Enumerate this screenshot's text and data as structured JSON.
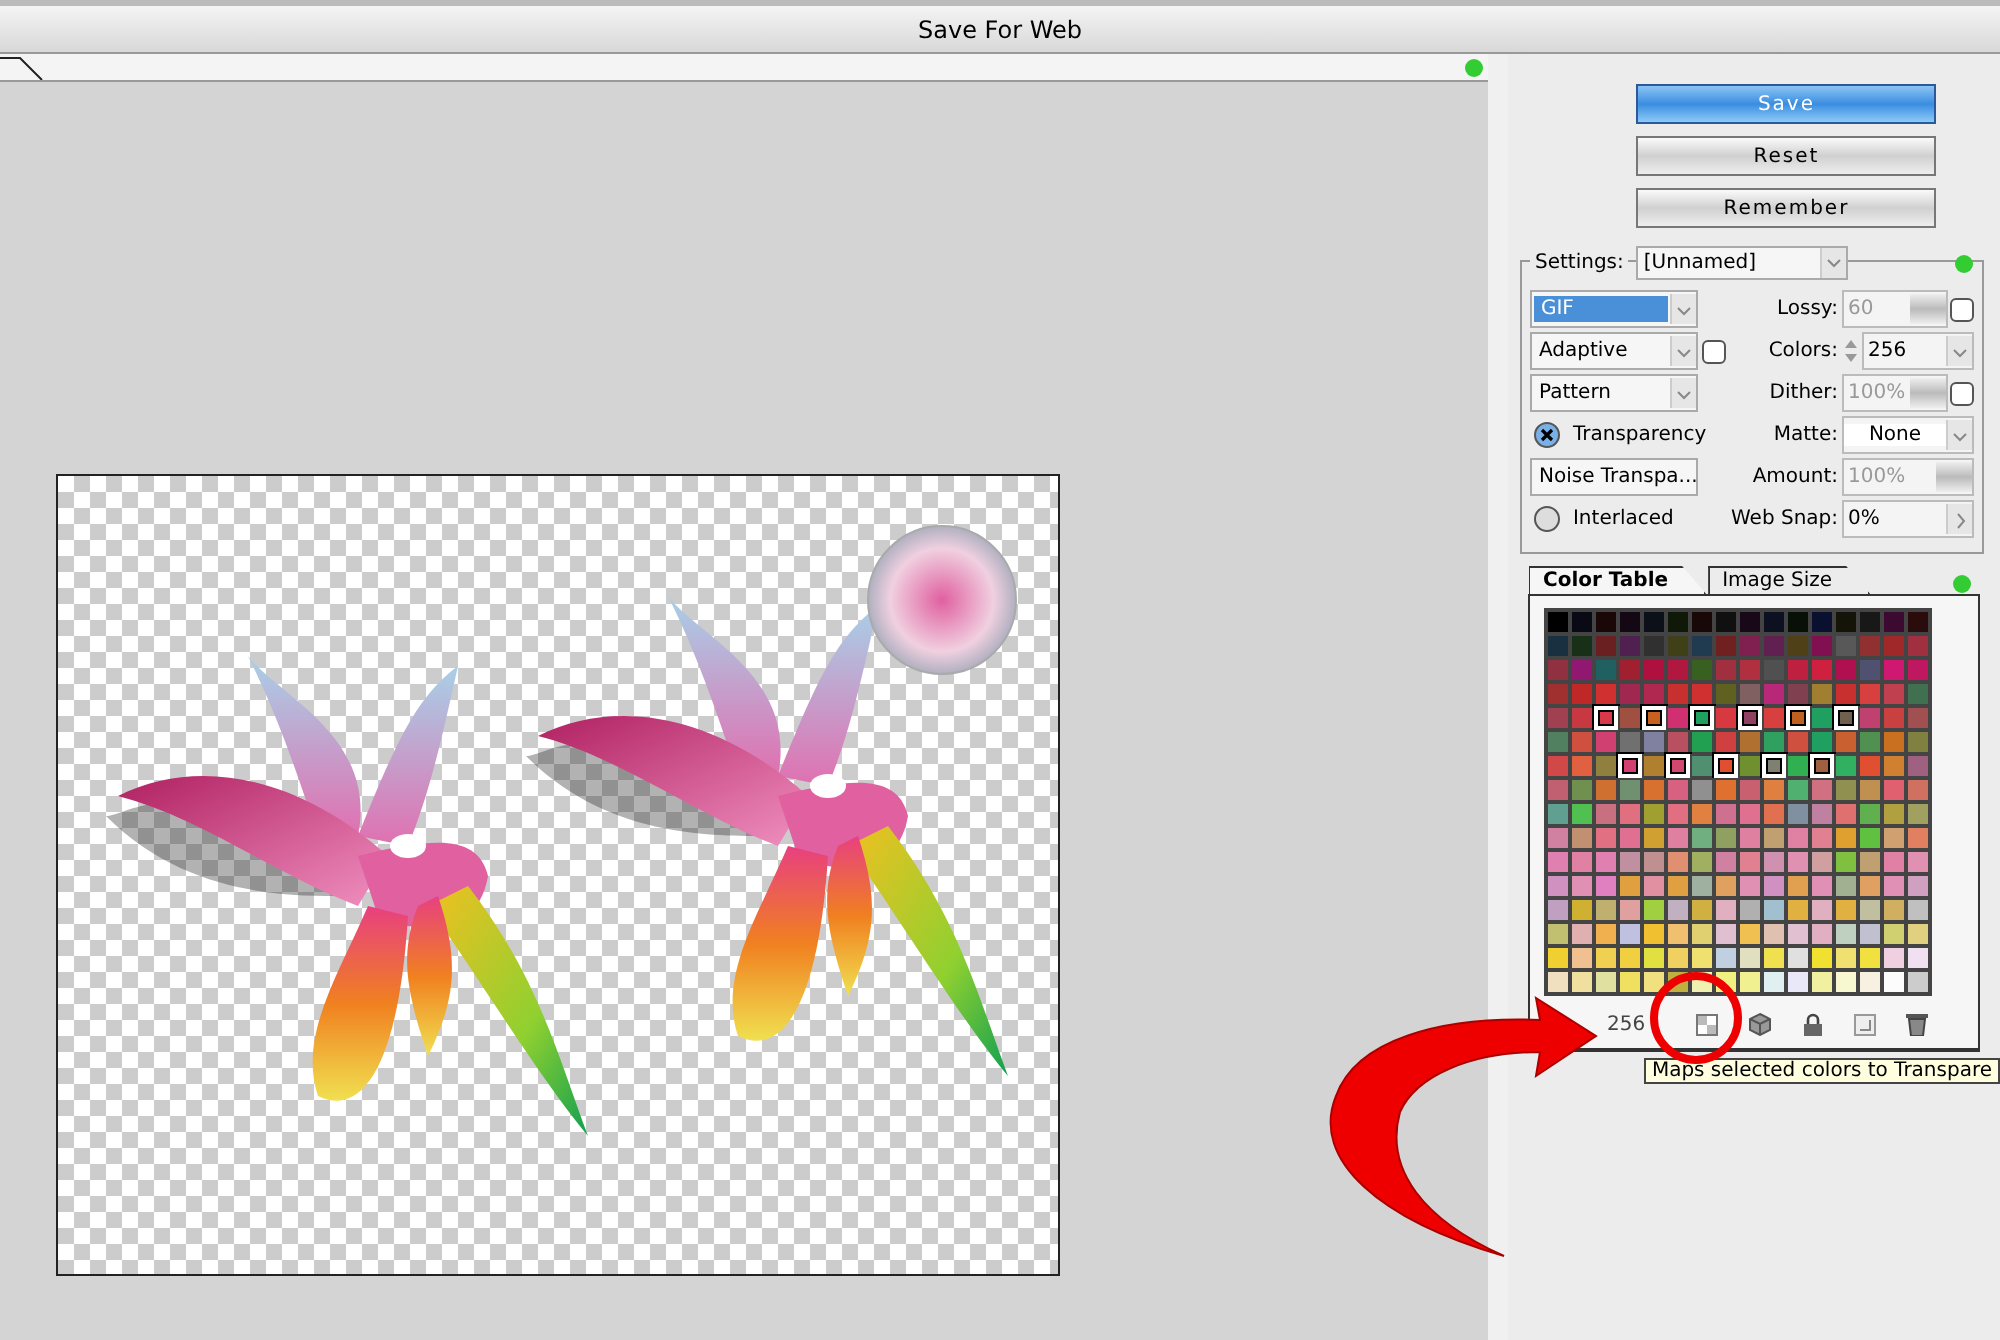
{
  "window": {
    "title": "Save For Web"
  },
  "buttons": [
    {
      "label": "Save",
      "default": true
    },
    {
      "label": "Reset",
      "default": false
    },
    {
      "label": "Remember",
      "default": false
    }
  ],
  "settings": {
    "label": "Settings:",
    "preset": "[Unnamed]",
    "left": [
      {
        "kind": "dropdown",
        "value": "GIF",
        "highlighted": true,
        "extra_button": false
      },
      {
        "kind": "dropdown",
        "value": "Adaptive",
        "highlighted": false,
        "extra_button": true
      },
      {
        "kind": "dropdown",
        "value": "Pattern",
        "highlighted": false,
        "extra_button": false
      },
      {
        "kind": "checkbox",
        "label": "Transparency",
        "checked": true
      },
      {
        "kind": "dropdown",
        "value": "Noise Transpa...",
        "highlighted": false,
        "extra_button": false
      },
      {
        "kind": "checkbox",
        "label": "Interlaced",
        "checked": false
      }
    ],
    "right": [
      {
        "kind": "slider",
        "label": "Lossy:",
        "value": "60",
        "disabled": true,
        "extra_button": true
      },
      {
        "kind": "stepper",
        "label": "Colors:",
        "value": "256",
        "disabled": false,
        "extra_button": false
      },
      {
        "kind": "slider",
        "label": "Dither:",
        "value": "100%",
        "disabled": true,
        "extra_button": true
      },
      {
        "kind": "dropdown",
        "label": "Matte:",
        "value": "None",
        "disabled": false,
        "extra_button": false
      },
      {
        "kind": "slider",
        "label": "Amount:",
        "value": "100%",
        "disabled": true,
        "extra_button": false
      },
      {
        "kind": "arrow",
        "label": "Web Snap:",
        "value": "0%",
        "disabled": false,
        "extra_button": false
      }
    ]
  },
  "tabs": [
    {
      "label": "Color Table",
      "selected": true
    },
    {
      "label": "Image Size",
      "selected": false
    }
  ],
  "color_table": {
    "count": "256",
    "tooltip": "Maps selected colors to Transpare",
    "rows": [
      {
        "swatches": [
          {
            "color": "#000000",
            "selected": false
          },
          {
            "color": "#0a0a14",
            "selected": false
          },
          {
            "color": "#1a0808",
            "selected": false
          },
          {
            "color": "#140814",
            "selected": false
          },
          {
            "color": "#0c1018",
            "selected": false
          },
          {
            "color": "#101808",
            "selected": false
          },
          {
            "color": "#180808",
            "selected": false
          },
          {
            "color": "#101010",
            "selected": false
          },
          {
            "color": "#180818",
            "selected": false
          },
          {
            "color": "#0c1020",
            "selected": false
          },
          {
            "color": "#081008",
            "selected": false
          },
          {
            "color": "#0c1030",
            "selected": false
          },
          {
            "color": "#141408",
            "selected": false
          },
          {
            "color": "#181818",
            "selected": false
          },
          {
            "color": "#3c0a30",
            "selected": false
          },
          {
            "color": "#2a0c0c",
            "selected": false
          }
        ]
      },
      {
        "swatches": [
          {
            "color": "#183040",
            "selected": false
          },
          {
            "color": "#183018",
            "selected": false
          },
          {
            "color": "#6a2020",
            "selected": false
          },
          {
            "color": "#502050",
            "selected": false
          },
          {
            "color": "#303030",
            "selected": false
          },
          {
            "color": "#404018",
            "selected": false
          },
          {
            "color": "#203a50",
            "selected": false
          },
          {
            "color": "#702020",
            "selected": false
          },
          {
            "color": "#802050",
            "selected": false
          },
          {
            "color": "#602050",
            "selected": false
          },
          {
            "color": "#504018",
            "selected": false
          },
          {
            "color": "#801050",
            "selected": false
          },
          {
            "color": "#585858",
            "selected": false
          },
          {
            "color": "#903030",
            "selected": false
          },
          {
            "color": "#a02828",
            "selected": false
          },
          {
            "color": "#a03040",
            "selected": false
          }
        ]
      },
      {
        "swatches": [
          {
            "color": "#903040",
            "selected": false
          },
          {
            "color": "#901870",
            "selected": false
          },
          {
            "color": "#206060",
            "selected": false
          },
          {
            "color": "#a02030",
            "selected": false
          },
          {
            "color": "#b01040",
            "selected": false
          },
          {
            "color": "#b01840",
            "selected": false
          },
          {
            "color": "#386020",
            "selected": false
          },
          {
            "color": "#a03040",
            "selected": false
          },
          {
            "color": "#b03040",
            "selected": false
          },
          {
            "color": "#505050",
            "selected": false
          },
          {
            "color": "#c02040",
            "selected": false
          },
          {
            "color": "#d02040",
            "selected": false
          },
          {
            "color": "#b01050",
            "selected": false
          },
          {
            "color": "#505070",
            "selected": false
          },
          {
            "color": "#d01870",
            "selected": false
          },
          {
            "color": "#c01860",
            "selected": false
          }
        ]
      },
      {
        "swatches": [
          {
            "color": "#a03030",
            "selected": false
          },
          {
            "color": "#c02828",
            "selected": false
          },
          {
            "color": "#d03030",
            "selected": false
          },
          {
            "color": "#a02850",
            "selected": false
          },
          {
            "color": "#b02850",
            "selected": false
          },
          {
            "color": "#c83030",
            "selected": false
          },
          {
            "color": "#d03030",
            "selected": false
          },
          {
            "color": "#606020",
            "selected": false
          },
          {
            "color": "#806060",
            "selected": false
          },
          {
            "color": "#b82878",
            "selected": false
          },
          {
            "color": "#804050",
            "selected": false
          },
          {
            "color": "#a08030",
            "selected": false
          },
          {
            "color": "#c83030",
            "selected": false
          },
          {
            "color": "#d84040",
            "selected": false
          },
          {
            "color": "#c04050",
            "selected": false
          },
          {
            "color": "#407050",
            "selected": false
          }
        ]
      },
      {
        "swatches": [
          {
            "color": "#a04050",
            "selected": false
          },
          {
            "color": "#c83840",
            "selected": false
          },
          {
            "color": "#d83848",
            "selected": true
          },
          {
            "color": "#a05040",
            "selected": false
          },
          {
            "color": "#c86020",
            "selected": true
          },
          {
            "color": "#d03070",
            "selected": false
          },
          {
            "color": "#20a060",
            "selected": true
          },
          {
            "color": "#d83840",
            "selected": false
          },
          {
            "color": "#904060",
            "selected": true
          },
          {
            "color": "#d84040",
            "selected": false
          },
          {
            "color": "#c06020",
            "selected": true
          },
          {
            "color": "#20a060",
            "selected": false
          },
          {
            "color": "#706050",
            "selected": true
          },
          {
            "color": "#c04070",
            "selected": false
          },
          {
            "color": "#c84040",
            "selected": false
          },
          {
            "color": "#a05050",
            "selected": false
          }
        ]
      },
      {
        "swatches": [
          {
            "color": "#508060",
            "selected": false
          },
          {
            "color": "#d05040",
            "selected": false
          },
          {
            "color": "#d04070",
            "selected": false
          },
          {
            "color": "#707070",
            "selected": false
          },
          {
            "color": "#8080a0",
            "selected": false
          },
          {
            "color": "#b85060",
            "selected": false
          },
          {
            "color": "#20a050",
            "selected": false
          },
          {
            "color": "#d04040",
            "selected": false
          },
          {
            "color": "#b07030",
            "selected": false
          },
          {
            "color": "#30a060",
            "selected": false
          },
          {
            "color": "#d05040",
            "selected": false
          },
          {
            "color": "#20a060",
            "selected": false
          },
          {
            "color": "#c86030",
            "selected": false
          },
          {
            "color": "#509050",
            "selected": false
          },
          {
            "color": "#c87020",
            "selected": false
          },
          {
            "color": "#808040",
            "selected": false
          }
        ]
      },
      {
        "swatches": [
          {
            "color": "#d04848",
            "selected": false
          },
          {
            "color": "#e06040",
            "selected": false
          },
          {
            "color": "#908040",
            "selected": false
          },
          {
            "color": "#d04070",
            "selected": true
          },
          {
            "color": "#b08030",
            "selected": false
          },
          {
            "color": "#d04870",
            "selected": true
          },
          {
            "color": "#509070",
            "selected": false
          },
          {
            "color": "#e05030",
            "selected": true
          },
          {
            "color": "#709030",
            "selected": false
          },
          {
            "color": "#808070",
            "selected": true
          },
          {
            "color": "#30b050",
            "selected": false
          },
          {
            "color": "#a06040",
            "selected": true
          },
          {
            "color": "#30b060",
            "selected": false
          },
          {
            "color": "#e05030",
            "selected": false
          },
          {
            "color": "#d08030",
            "selected": false
          },
          {
            "color": "#a06080",
            "selected": false
          }
        ]
      },
      {
        "swatches": [
          {
            "color": "#c06070",
            "selected": false
          },
          {
            "color": "#709050",
            "selected": false
          },
          {
            "color": "#d07030",
            "selected": false
          },
          {
            "color": "#709070",
            "selected": false
          },
          {
            "color": "#d87030",
            "selected": false
          },
          {
            "color": "#d86080",
            "selected": false
          },
          {
            "color": "#909090",
            "selected": false
          },
          {
            "color": "#e07030",
            "selected": false
          },
          {
            "color": "#c86070",
            "selected": false
          },
          {
            "color": "#e08040",
            "selected": false
          },
          {
            "color": "#50b070",
            "selected": false
          },
          {
            "color": "#d07080",
            "selected": false
          },
          {
            "color": "#909050",
            "selected": false
          },
          {
            "color": "#c09050",
            "selected": false
          },
          {
            "color": "#e06070",
            "selected": false
          },
          {
            "color": "#d07060",
            "selected": false
          }
        ]
      },
      {
        "swatches": [
          {
            "color": "#60a090",
            "selected": false
          },
          {
            "color": "#50c050",
            "selected": false
          },
          {
            "color": "#c87080",
            "selected": false
          },
          {
            "color": "#e07080",
            "selected": false
          },
          {
            "color": "#a0a030",
            "selected": false
          },
          {
            "color": "#e07081",
            "selected": false
          },
          {
            "color": "#e08041",
            "selected": false
          },
          {
            "color": "#d07090",
            "selected": false
          },
          {
            "color": "#e07090",
            "selected": false
          },
          {
            "color": "#e07050",
            "selected": false
          },
          {
            "color": "#8090a0",
            "selected": false
          },
          {
            "color": "#c080a0",
            "selected": false
          },
          {
            "color": "#e07070",
            "selected": false
          },
          {
            "color": "#60b050",
            "selected": false
          },
          {
            "color": "#b0a040",
            "selected": false
          },
          {
            "color": "#a0a060",
            "selected": false
          }
        ]
      },
      {
        "swatches": [
          {
            "color": "#d080a0",
            "selected": false
          },
          {
            "color": "#c09070",
            "selected": false
          },
          {
            "color": "#e07082",
            "selected": false
          },
          {
            "color": "#e07091",
            "selected": false
          },
          {
            "color": "#d0a030",
            "selected": false
          },
          {
            "color": "#e080a0",
            "selected": false
          },
          {
            "color": "#70b080",
            "selected": false
          },
          {
            "color": "#90a060",
            "selected": false
          },
          {
            "color": "#e080a1",
            "selected": false
          },
          {
            "color": "#c0a070",
            "selected": false
          },
          {
            "color": "#e080a2",
            "selected": false
          },
          {
            "color": "#e08090",
            "selected": false
          },
          {
            "color": "#e0a030",
            "selected": false
          },
          {
            "color": "#60c040",
            "selected": false
          },
          {
            "color": "#d0a070",
            "selected": false
          },
          {
            "color": "#e08060",
            "selected": false
          }
        ]
      },
      {
        "swatches": [
          {
            "color": "#e080b0",
            "selected": false
          },
          {
            "color": "#e080a3",
            "selected": false
          },
          {
            "color": "#e080b1",
            "selected": false
          },
          {
            "color": "#c090a0",
            "selected": false
          },
          {
            "color": "#c09090",
            "selected": false
          },
          {
            "color": "#e09070",
            "selected": false
          },
          {
            "color": "#a0b060",
            "selected": false
          },
          {
            "color": "#d080a1",
            "selected": false
          },
          {
            "color": "#e08091",
            "selected": false
          },
          {
            "color": "#d090b0",
            "selected": false
          },
          {
            "color": "#e090b0",
            "selected": false
          },
          {
            "color": "#d0a0a0",
            "selected": false
          },
          {
            "color": "#80c040",
            "selected": false
          },
          {
            "color": "#c0a071",
            "selected": false
          },
          {
            "color": "#e080a4",
            "selected": false
          },
          {
            "color": "#e090b1",
            "selected": false
          }
        ]
      },
      {
        "swatches": [
          {
            "color": "#d090c0",
            "selected": false
          },
          {
            "color": "#e090b2",
            "selected": false
          },
          {
            "color": "#e080c0",
            "selected": false
          },
          {
            "color": "#e0a040",
            "selected": false
          },
          {
            "color": "#e090a0",
            "selected": false
          },
          {
            "color": "#e0a041",
            "selected": false
          },
          {
            "color": "#a0b0a0",
            "selected": false
          },
          {
            "color": "#e0a060",
            "selected": false
          },
          {
            "color": "#e090b3",
            "selected": false
          },
          {
            "color": "#d090c1",
            "selected": false
          },
          {
            "color": "#e0a050",
            "selected": false
          },
          {
            "color": "#e090b4",
            "selected": false
          },
          {
            "color": "#a0b090",
            "selected": false
          },
          {
            "color": "#e0a061",
            "selected": false
          },
          {
            "color": "#e090b5",
            "selected": false
          },
          {
            "color": "#d0a0c0",
            "selected": false
          }
        ]
      },
      {
        "swatches": [
          {
            "color": "#c0a0c0",
            "selected": false
          },
          {
            "color": "#d0b030",
            "selected": false
          },
          {
            "color": "#c0b070",
            "selected": false
          },
          {
            "color": "#e0a0a0",
            "selected": false
          },
          {
            "color": "#a0d040",
            "selected": false
          },
          {
            "color": "#c0b0c0",
            "selected": false
          },
          {
            "color": "#d0b040",
            "selected": false
          },
          {
            "color": "#e0b0c0",
            "selected": false
          },
          {
            "color": "#b0b0b0",
            "selected": false
          },
          {
            "color": "#a0c0d0",
            "selected": false
          },
          {
            "color": "#e0b040",
            "selected": false
          },
          {
            "color": "#e0b0c1",
            "selected": false
          },
          {
            "color": "#e0b041",
            "selected": false
          },
          {
            "color": "#c0c0a0",
            "selected": false
          },
          {
            "color": "#d0b060",
            "selected": false
          },
          {
            "color": "#c0c0c0",
            "selected": false
          }
        ]
      },
      {
        "swatches": [
          {
            "color": "#c0c070",
            "selected": false
          },
          {
            "color": "#e0b0b0",
            "selected": false
          },
          {
            "color": "#f0b050",
            "selected": false
          },
          {
            "color": "#c0c0e0",
            "selected": false
          },
          {
            "color": "#f0c030",
            "selected": false
          },
          {
            "color": "#f0c070",
            "selected": false
          },
          {
            "color": "#e0d070",
            "selected": false
          },
          {
            "color": "#e0c0d0",
            "selected": false
          },
          {
            "color": "#f0c050",
            "selected": false
          },
          {
            "color": "#e0c0b0",
            "selected": false
          },
          {
            "color": "#e0c0d1",
            "selected": false
          },
          {
            "color": "#e0b0c2",
            "selected": false
          },
          {
            "color": "#c0d0c0",
            "selected": false
          },
          {
            "color": "#c0c0d0",
            "selected": false
          },
          {
            "color": "#d0d070",
            "selected": false
          },
          {
            "color": "#e0d080",
            "selected": false
          }
        ]
      },
      {
        "swatches": [
          {
            "color": "#f0d030",
            "selected": false
          },
          {
            "color": "#f0c090",
            "selected": false
          },
          {
            "color": "#f0d050",
            "selected": false
          },
          {
            "color": "#f0d040",
            "selected": false
          },
          {
            "color": "#e0e040",
            "selected": false
          },
          {
            "color": "#f0d060",
            "selected": false
          },
          {
            "color": "#f0e070",
            "selected": false
          },
          {
            "color": "#c0d0e0",
            "selected": false
          },
          {
            "color": "#e0e0c0",
            "selected": false
          },
          {
            "color": "#f0e050",
            "selected": false
          },
          {
            "color": "#e0e0e0",
            "selected": false
          },
          {
            "color": "#f0e030",
            "selected": false
          },
          {
            "color": "#f0e071",
            "selected": false
          },
          {
            "color": "#f0e040",
            "selected": false
          },
          {
            "color": "#f0d0e0",
            "selected": false
          },
          {
            "color": "#f0e0f0",
            "selected": false
          }
        ]
      },
      {
        "swatches": [
          {
            "color": "#f0e0c0",
            "selected": false
          },
          {
            "color": "#f0e0a0",
            "selected": false
          },
          {
            "color": "#e0e0a0",
            "selected": false
          },
          {
            "color": "#f0e060",
            "selected": false
          },
          {
            "color": "#f0e080",
            "selected": false
          },
          {
            "color": "#c0b040",
            "selected": false
          },
          {
            "color": "#f0f0b0",
            "selected": false
          },
          {
            "color": "#f0f080",
            "selected": false
          },
          {
            "color": "#f0f090",
            "selected": false
          },
          {
            "color": "#e0f0f0",
            "selected": false
          },
          {
            "color": "#e8e8f8",
            "selected": false
          },
          {
            "color": "#f0f0a0",
            "selected": false
          },
          {
            "color": "#f8f8d0",
            "selected": false
          },
          {
            "color": "#f8f0e0",
            "selected": false
          },
          {
            "color": "#fcfcfc",
            "selected": false
          },
          {
            "color": "#cccccc",
            "selected": false
          }
        ]
      }
    ]
  }
}
